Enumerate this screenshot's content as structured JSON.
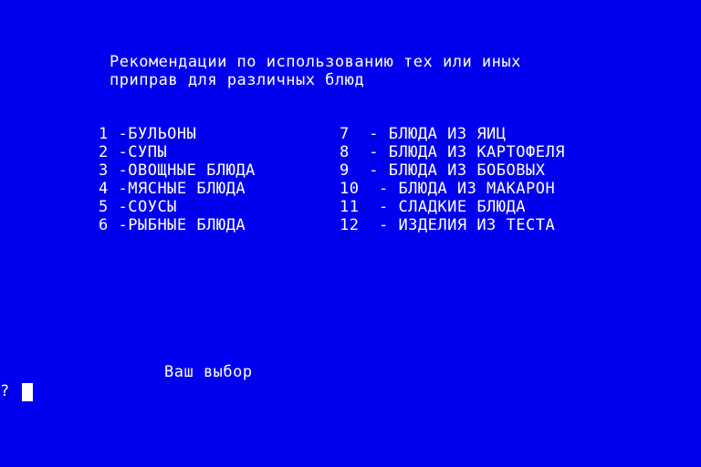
{
  "header": {
    "line1": "Рекомендации по использованию тех или иных",
    "line2": "приправ для различных блюд"
  },
  "menu": {
    "left": [
      {
        "num": "1",
        "label": "-БУЛЬОНЫ"
      },
      {
        "num": "2",
        "label": "-СУПЫ"
      },
      {
        "num": "3",
        "label": "-ОВОЩНЫЕ БЛЮДА"
      },
      {
        "num": "4",
        "label": "-МЯСНЫЕ БЛЮДА"
      },
      {
        "num": "5",
        "label": "-СОУСЫ"
      },
      {
        "num": "6",
        "label": "-РЫБНЫЕ БЛЮДА"
      }
    ],
    "right": [
      {
        "num": "7",
        "label": "- БЛЮДА ИЗ ЯИЦ"
      },
      {
        "num": "8",
        "label": "- БЛЮДА ИЗ КАРТОФЕЛЯ"
      },
      {
        "num": "9",
        "label": "- БЛЮДА ИЗ БОБОВЫХ"
      },
      {
        "num": "10",
        "label": "- БЛЮДА ИЗ МАКАРОН"
      },
      {
        "num": "11",
        "label": "- СЛАДКИЕ БЛЮДА"
      },
      {
        "num": "12",
        "label": "- ИЗДЕЛИЯ ИЗ ТЕСТА"
      }
    ]
  },
  "prompt": {
    "label": "Ваш выбор",
    "symbol": "?"
  },
  "colors": {
    "background": "#0000ee",
    "text": "#ffffff"
  }
}
